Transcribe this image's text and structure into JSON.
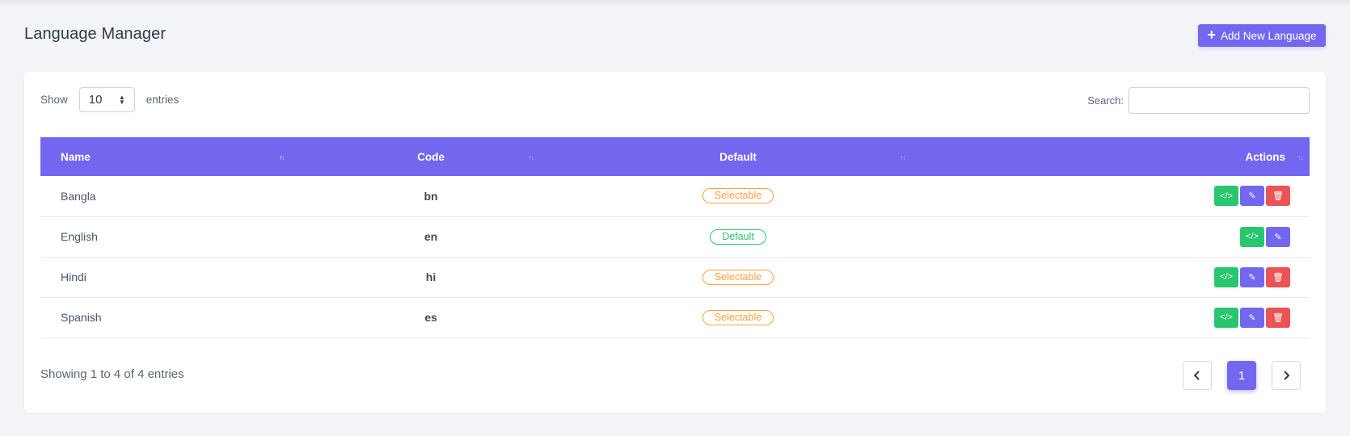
{
  "header": {
    "title": "Language Manager",
    "add_button_label": "Add New Language"
  },
  "length_menu": {
    "prefix": "Show",
    "value": "10",
    "suffix": "entries"
  },
  "search": {
    "label": "Search:",
    "value": ""
  },
  "table": {
    "columns": [
      "Name",
      "Code",
      "Default",
      "Actions"
    ],
    "rows": [
      {
        "name": "Bangla",
        "code": "bn",
        "status": "Selectable"
      },
      {
        "name": "English",
        "code": "en",
        "status": "Default"
      },
      {
        "name": "Hindi",
        "code": "hi",
        "status": "Selectable"
      },
      {
        "name": "Spanish",
        "code": "es",
        "status": "Selectable"
      }
    ]
  },
  "footer": {
    "info": "Showing 1 to 4 of 4 entries"
  },
  "pagination": {
    "prev_icon": "chevron-left-icon",
    "current_page": "1",
    "next_icon": "chevron-right-icon"
  },
  "colors": {
    "primary": "#7367f0",
    "success": "#28c76f",
    "warning": "#ff9f43",
    "danger": "#ea5455",
    "background": "#f3f4f7"
  },
  "icons": {
    "add": "plus-icon",
    "code": "code-icon",
    "edit": "edit-icon",
    "delete": "trash-icon"
  }
}
